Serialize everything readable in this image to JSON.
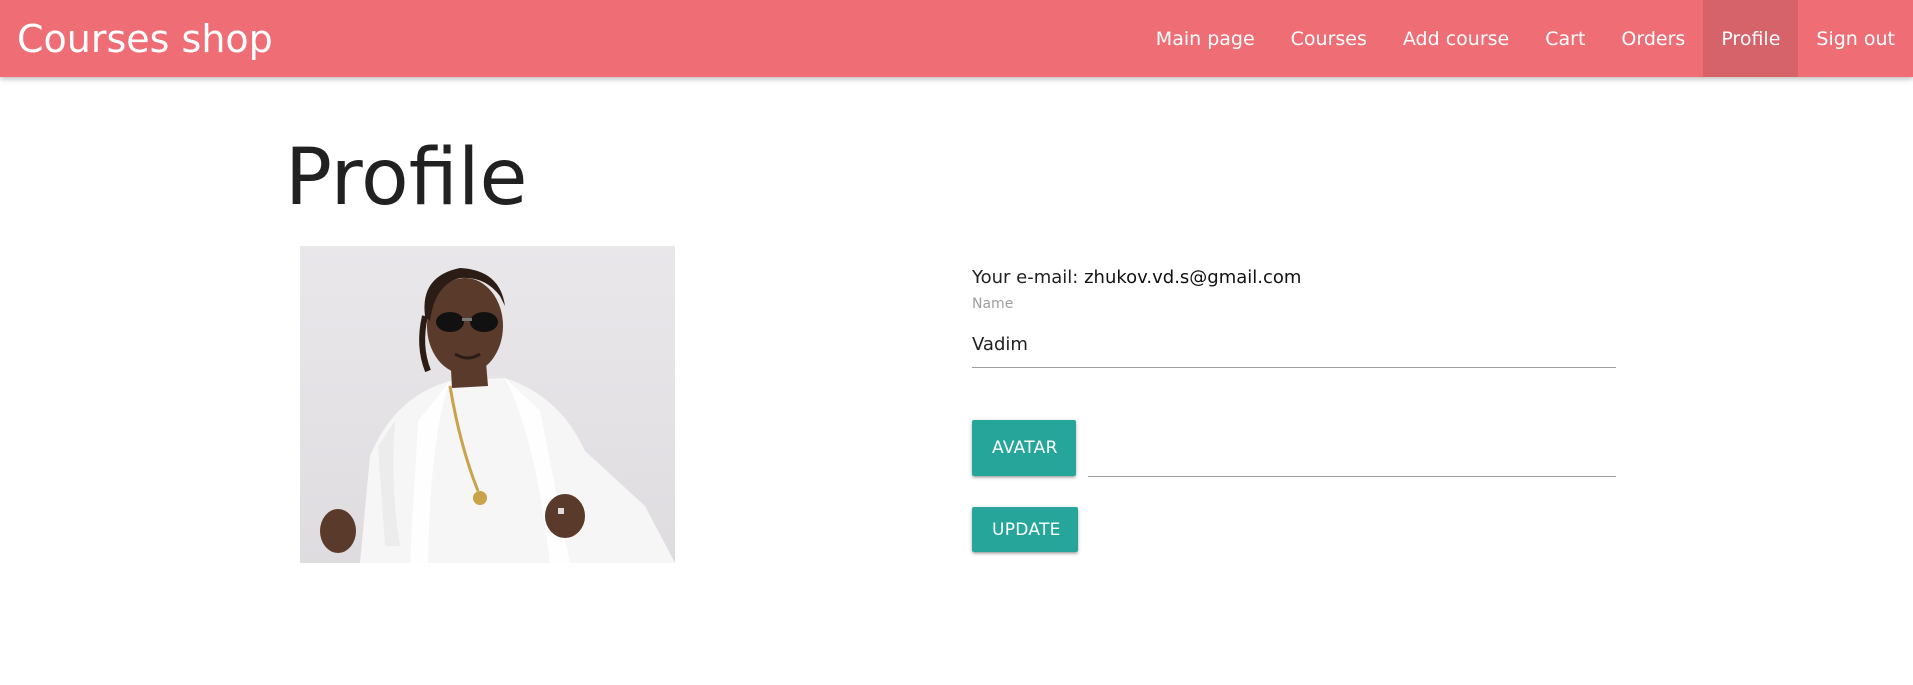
{
  "navbar": {
    "brand": "Courses shop",
    "background_color": "#ef6e76",
    "links": [
      {
        "label": "Main page",
        "active": false
      },
      {
        "label": "Courses",
        "active": false
      },
      {
        "label": "Add course",
        "active": false
      },
      {
        "label": "Cart",
        "active": false
      },
      {
        "label": "Orders",
        "active": false
      },
      {
        "label": "Profile",
        "active": true
      },
      {
        "label": "Sign out",
        "active": false
      }
    ]
  },
  "main": {
    "title": "Profile",
    "email_label": "Your e-mail:",
    "email_value": "zhukov.vd.s@gmail.com",
    "name_label": "Name",
    "name_value": "Vadim",
    "avatar_button": "Avatar",
    "file_path_value": "",
    "update_button": "Update",
    "button_color": "#26a69a"
  }
}
